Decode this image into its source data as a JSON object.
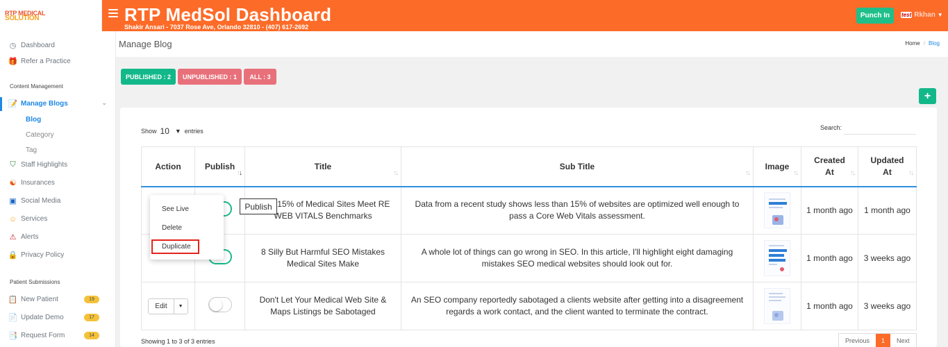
{
  "header": {
    "logo_line1": "RTP MEDICAL",
    "logo_line2": "SOLUTION",
    "title": "RTP MedSol Dashboard",
    "subtitle": "Shakir Ansari - 7037 Rose Ave, Orlando 32810 - (407) 617-2692",
    "punch_in": "Punch In",
    "user_badge": "test",
    "user_name": "Rkhan",
    "accent_color": "#fd6b28"
  },
  "sidebar": {
    "dashboard": "Dashboard",
    "refer": "Refer a Practice",
    "section_content": "Content Management",
    "manage_blogs": "Manage Blogs",
    "sub_blog": "Blog",
    "sub_category": "Category",
    "sub_tag": "Tag",
    "staff": "Staff Highlights",
    "insurances": "Insurances",
    "social": "Social Media",
    "services": "Services",
    "alerts": "Alerts",
    "privacy": "Privacy Policy",
    "section_patient": "Patient Submissions",
    "new_patient": "New Patient",
    "new_patient_count": "19",
    "update_demo": "Update Demo",
    "update_demo_count": "17",
    "request_form": "Request Form",
    "request_form_count": "14"
  },
  "page": {
    "title": "Manage Blog",
    "breadcrumb_home": "Home",
    "breadcrumb_current": "Blog"
  },
  "filters": {
    "published": "PUBLISHED : 2",
    "unpublished": "UNPUBLISHED : 1",
    "all": "ALL : 3"
  },
  "table_controls": {
    "show": "Show",
    "length": "10",
    "entries": "entries",
    "search_label": "Search:",
    "search_value": ""
  },
  "table": {
    "columns": [
      "Action",
      "Publish",
      "Title",
      "Sub Title",
      "Image",
      "Created At",
      "Updated At"
    ],
    "rows": [
      {
        "title": "Than 15% of Medical Sites Meet RE WEB VITALS Benchmarks",
        "subtitle": "Data from a recent study shows less than 15% of websites are optimized well enough to pass a Core Web Vitals assessment.",
        "created": "1 month ago",
        "updated": "1 month ago",
        "published": true
      },
      {
        "title": "8 Silly But Harmful SEO Mistakes Medical Sites Make",
        "subtitle": "A whole lot of things can go wrong in SEO. In this article, I'll highlight eight damaging mistakes SEO medical websites should look out for.",
        "created": "1 month ago",
        "updated": "3 weeks ago",
        "published": true
      },
      {
        "title": "Don't Let Your Medical Web Site & Maps Listings be Sabotaged",
        "subtitle": "An SEO company reportedly sabotaged a clients website after getting into a disagreement regards a work contact, and the client wanted to terminate the contract.",
        "created": "1 month ago",
        "updated": "3 weeks ago",
        "published": false
      }
    ],
    "edit_label": "Edit"
  },
  "dropdown": {
    "see_live": "See Live",
    "delete": "Delete",
    "duplicate": "Duplicate"
  },
  "tooltip": "Publish",
  "footer": {
    "info": "Showing 1 to 3 of 3 entries",
    "previous": "Previous",
    "page": "1",
    "next": "Next"
  }
}
